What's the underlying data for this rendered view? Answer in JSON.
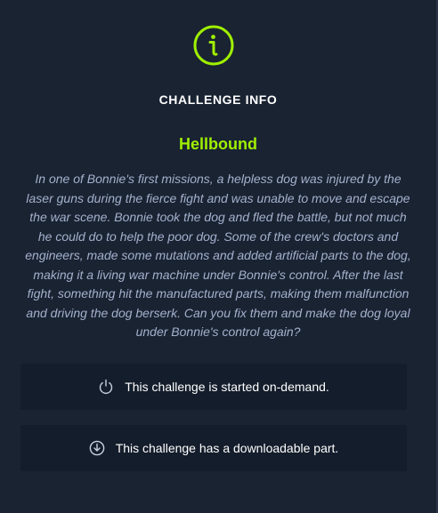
{
  "panel": {
    "title": "CHALLENGE INFO",
    "icon": "info-icon",
    "accent_color": "#9fef00"
  },
  "challenge": {
    "name": "Hellbound",
    "description": "In one of Bonnie's first missions, a helpless dog was injured by the laser guns during the fierce fight and was unable to move and escape the war scene. Bonnie took the dog and fled the battle, but not much he could do to help the poor dog. Some of the crew's doctors and engineers, made some mutations and added artificial parts to the dog, making it a living war machine under Bonnie's control. After the last fight, something hit the manufactured parts, making them malfunction and driving the dog berserk. Can you fix them and make the dog loyal under Bonnie's control again?"
  },
  "notices": [
    {
      "icon": "power-icon",
      "text": "This challenge is started on-demand."
    },
    {
      "icon": "download-icon",
      "text": "This challenge has a downloadable part."
    }
  ]
}
